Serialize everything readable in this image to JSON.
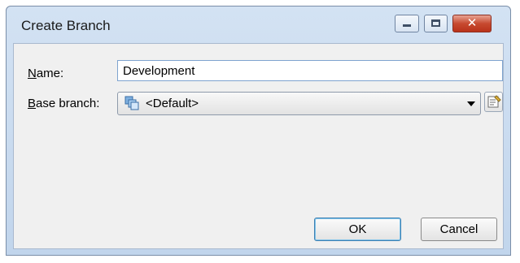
{
  "window": {
    "title": "Create Branch",
    "controls": {
      "minimize": "minimize",
      "maximize": "maximize",
      "close": "close",
      "close_glyph": "✕"
    }
  },
  "form": {
    "name_label_accel": "N",
    "name_label_rest": "ame:",
    "name_value": "Development",
    "base_label_accel": "B",
    "base_label_rest": "ase branch:",
    "base_value": "<Default>",
    "base_icon": "branch-icon",
    "properties_icon": "properties-icon"
  },
  "buttons": {
    "ok": "OK",
    "cancel": "Cancel"
  },
  "colors": {
    "close_button": "#c74a30",
    "focus_border": "#3c7fb1",
    "titlebar": "#c1d5ec"
  }
}
